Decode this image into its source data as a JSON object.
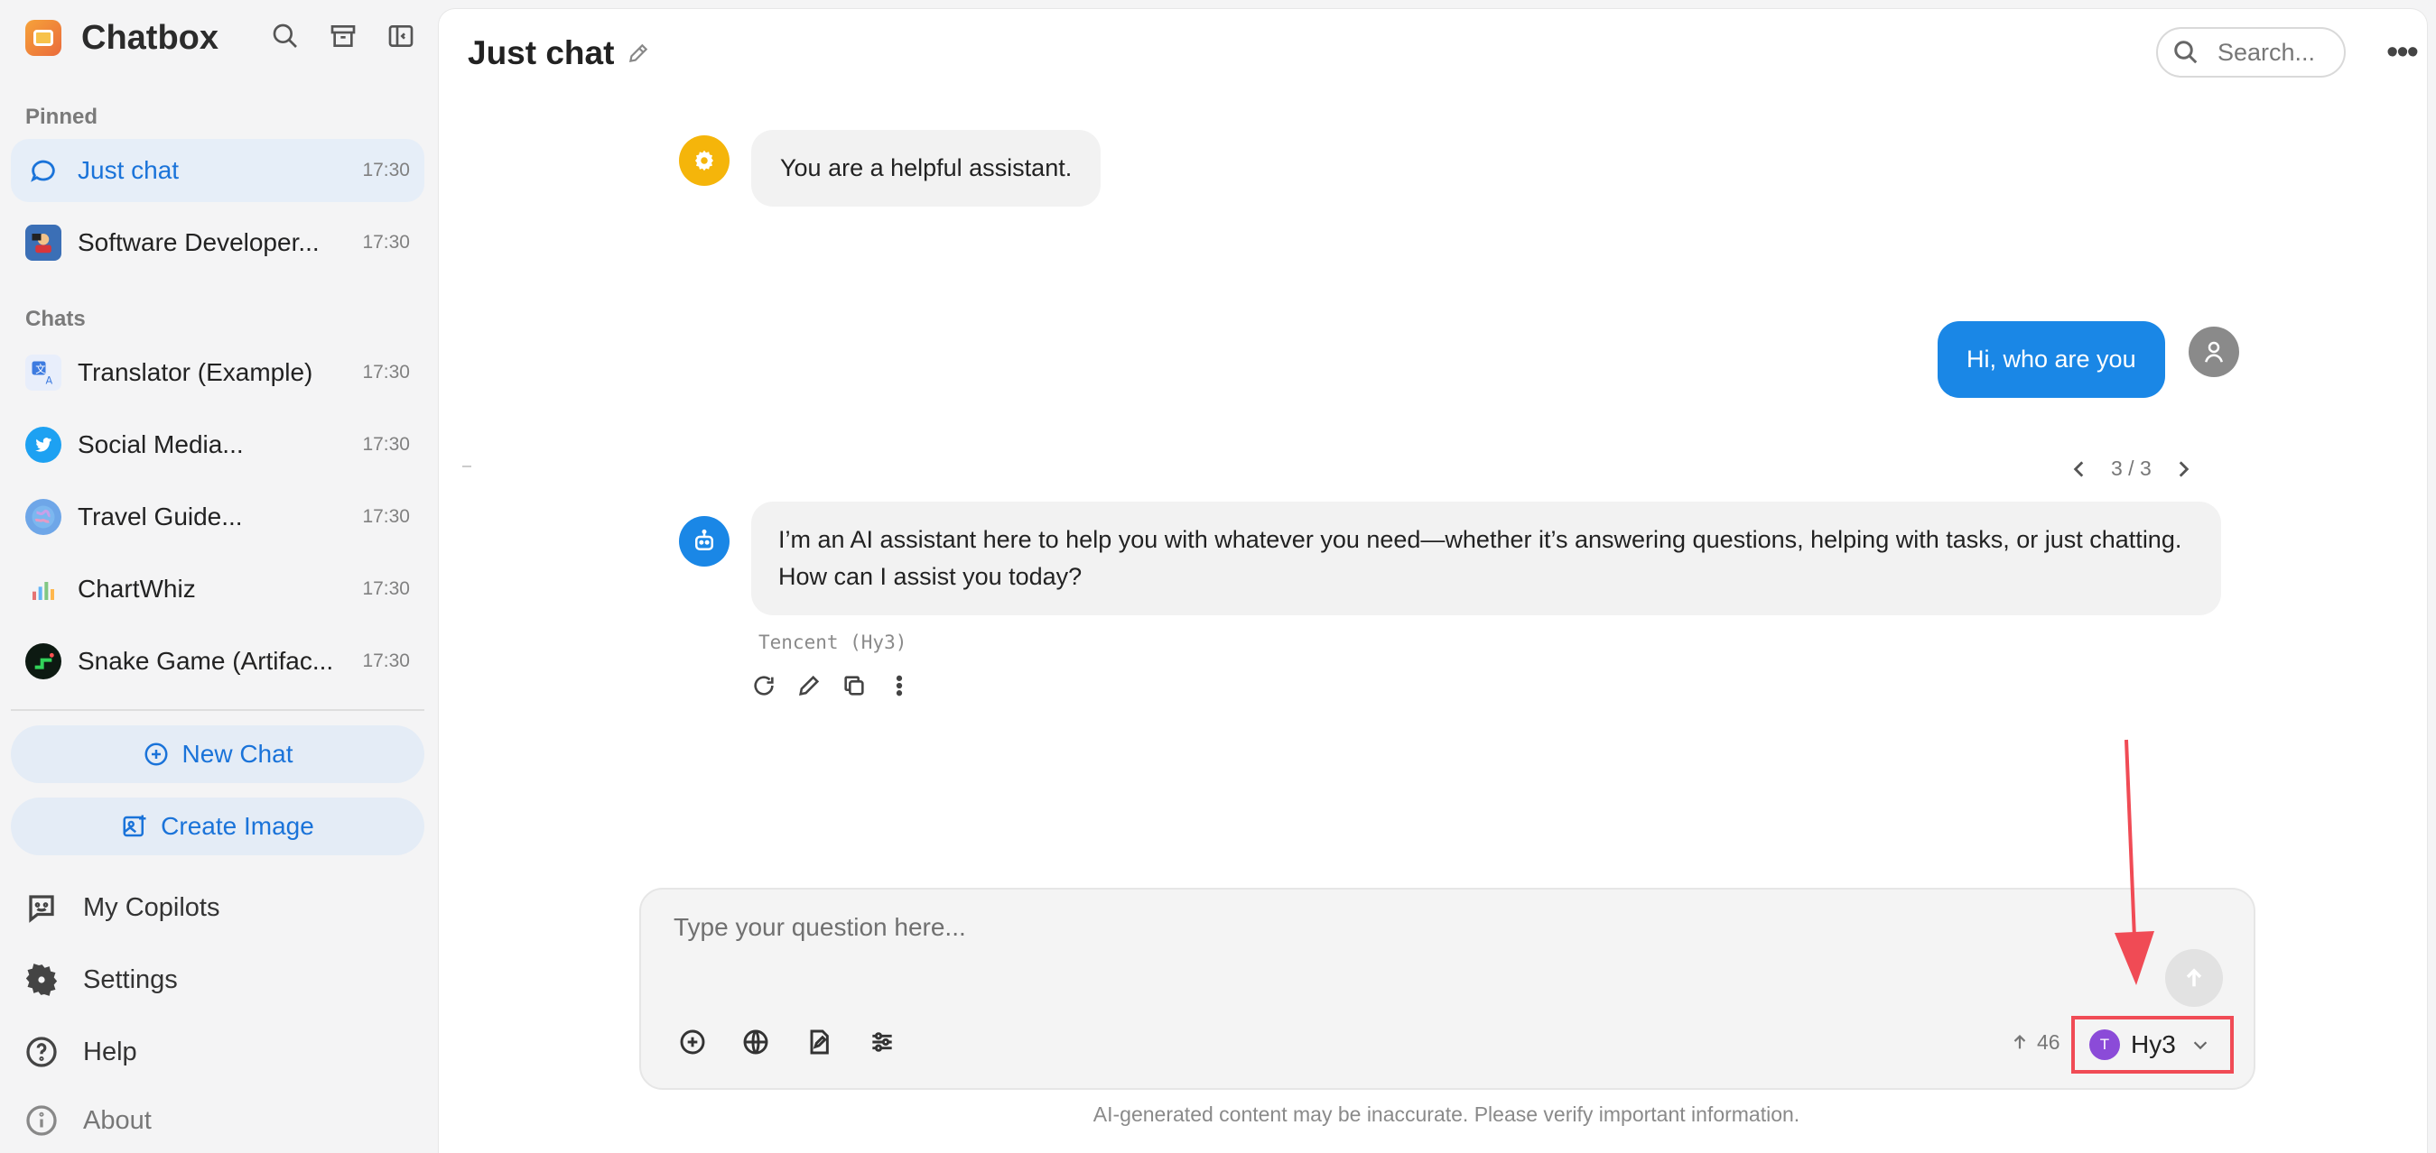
{
  "app": {
    "name": "Chatbox"
  },
  "sidebar": {
    "pinned_label": "Pinned",
    "chats_label": "Chats",
    "pinned": [
      {
        "name": "Just chat",
        "time": "17:30",
        "icon": "chat-bubble-icon"
      },
      {
        "name": "Software Developer...",
        "time": "17:30",
        "icon": "developer-avatar-icon"
      }
    ],
    "chats": [
      {
        "name": "Translator (Example)",
        "time": "17:30",
        "icon": "translate-icon"
      },
      {
        "name": "Social Media...",
        "time": "17:30",
        "icon": "twitter-icon"
      },
      {
        "name": "Travel Guide...",
        "time": "17:30",
        "icon": "globe-icon"
      },
      {
        "name": "ChartWhiz",
        "time": "17:30",
        "icon": "chart-icon"
      },
      {
        "name": "Snake Game (Artifac...",
        "time": "17:30",
        "icon": "snake-game-icon"
      }
    ],
    "new_chat": "New Chat",
    "create_image": "Create Image",
    "menu": {
      "copilots": "My Copilots",
      "settings": "Settings",
      "help": "Help",
      "about": "About"
    }
  },
  "header": {
    "title": "Just chat",
    "search_placeholder": "Search..."
  },
  "messages": {
    "system": "You are a helpful assistant.",
    "user": "Hi, who are you",
    "assistant": "I’m an AI assistant here to help you with whatever you need—whether it’s answering questions, helping with tasks, or just chatting. How can I assist you today?",
    "model_tag": "Tencent (Hy3)",
    "pager": "3 / 3"
  },
  "composer": {
    "placeholder": "Type your question here...",
    "token_count": "46",
    "model_initial": "T",
    "model_name": "Hy3"
  },
  "footer": {
    "disclaimer": "AI-generated content may be inaccurate. Please verify important information."
  },
  "colors": {
    "accent": "#1a73d9",
    "user_bubble": "#1a87e6",
    "highlight": "#f04b55",
    "system_avatar": "#f5b50a",
    "assistant_avatar": "#1a87e6"
  }
}
